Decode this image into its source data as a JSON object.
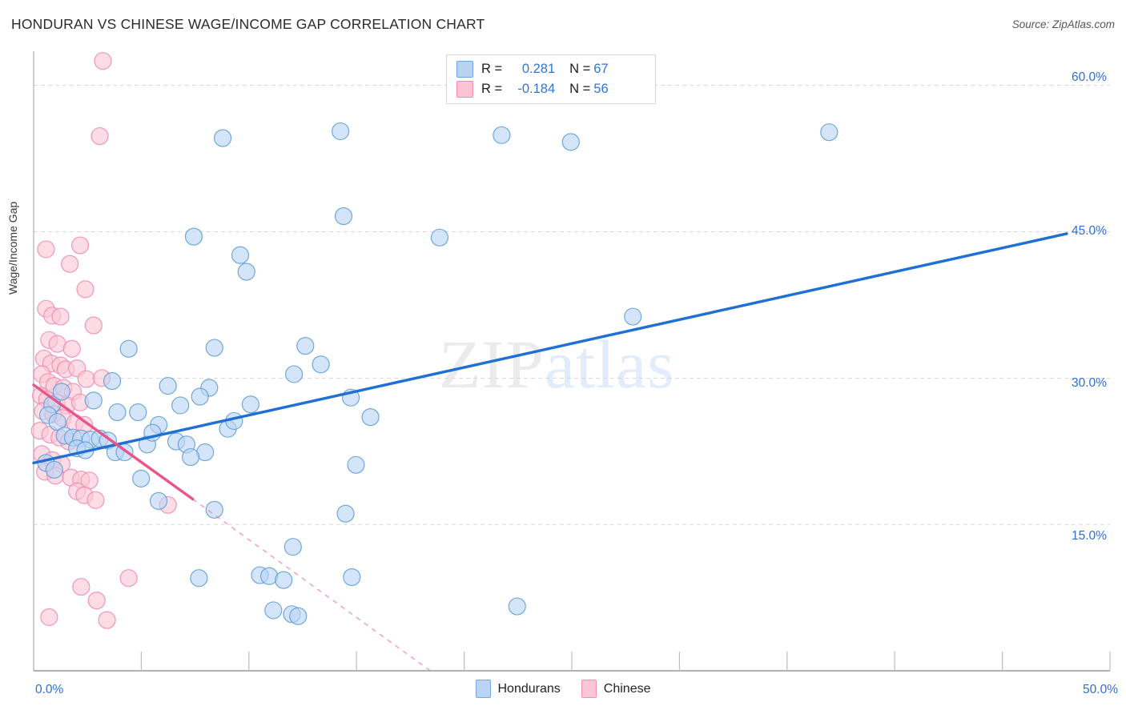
{
  "header": {
    "title": "HONDURAN VS CHINESE WAGE/INCOME GAP CORRELATION CHART",
    "source": "Source: ZipAtlas.com"
  },
  "watermark": {
    "part1": "ZIP",
    "part2": "atlas"
  },
  "stats": {
    "rows": [
      {
        "series": "Hondurans",
        "r_key": "R =",
        "r_value": "0.281",
        "n_key": "N =",
        "n_value": "67",
        "color": "#b8d3f2"
      },
      {
        "series": "Chinese",
        "r_key": "R =",
        "r_value": "-0.184",
        "n_key": "N =",
        "n_value": "56",
        "color": "#fbc4d4"
      }
    ]
  },
  "legend": {
    "items": [
      {
        "label": "Hondurans",
        "color": "#b9d4f5"
      },
      {
        "label": "Chinese",
        "color": "#fbc6d6"
      }
    ]
  },
  "axes": {
    "y_title": "Wage/Income Gap",
    "y_ticks": [
      "60.0%",
      "45.0%",
      "30.0%",
      "15.0%"
    ],
    "x_min_label": "0.0%",
    "x_max_label": "50.0%"
  },
  "chart_data": {
    "type": "scatter",
    "title": "HONDURAN VS CHINESE WAGE/INCOME GAP CORRELATION CHART",
    "xlabel": "",
    "ylabel": "Wage/Income Gap",
    "xlim": [
      0.0,
      50.0
    ],
    "ylim": [
      0.0,
      63.5
    ],
    "x_unit": "%",
    "y_unit": "%",
    "grid": true,
    "y_gridlines": [
      15.0,
      30.0,
      45.0,
      60.0
    ],
    "legend_position": "bottom-center",
    "series": [
      {
        "name": "Hondurans",
        "color": "#b9d4f5",
        "edge_color": "#5b9bd5",
        "r": 0.281,
        "n": 67,
        "trendline": {
          "x0": 0.0,
          "y0": 21.3,
          "x1": 50.0,
          "y1": 44.8,
          "style": "solid",
          "color": "#1f6fd4"
        },
        "points": [
          [
            14.85,
            55.3
          ],
          [
            22.65,
            54.9
          ],
          [
            26.0,
            54.2
          ],
          [
            38.5,
            55.2
          ],
          [
            9.15,
            54.6
          ],
          [
            15.0,
            46.6
          ],
          [
            7.75,
            44.5
          ],
          [
            19.65,
            44.4
          ],
          [
            10.0,
            42.6
          ],
          [
            10.3,
            40.9
          ],
          [
            4.6,
            33.0
          ],
          [
            8.75,
            33.1
          ],
          [
            13.15,
            33.3
          ],
          [
            29.0,
            36.3
          ],
          [
            13.9,
            31.4
          ],
          [
            3.8,
            29.7
          ],
          [
            6.5,
            29.2
          ],
          [
            12.6,
            30.4
          ],
          [
            8.5,
            29.0
          ],
          [
            2.9,
            27.7
          ],
          [
            7.1,
            27.2
          ],
          [
            8.05,
            28.1
          ],
          [
            4.05,
            26.5
          ],
          [
            5.05,
            26.5
          ],
          [
            6.05,
            25.2
          ],
          [
            9.4,
            24.8
          ],
          [
            10.5,
            27.3
          ],
          [
            15.35,
            28.0
          ],
          [
            16.3,
            26.0
          ],
          [
            0.9,
            27.3
          ],
          [
            0.7,
            26.2
          ],
          [
            1.15,
            25.5
          ],
          [
            1.5,
            24.1
          ],
          [
            1.9,
            23.9
          ],
          [
            2.3,
            23.8
          ],
          [
            2.75,
            23.7
          ],
          [
            3.2,
            23.8
          ],
          [
            3.6,
            23.6
          ],
          [
            2.1,
            22.8
          ],
          [
            2.5,
            22.6
          ],
          [
            3.95,
            22.4
          ],
          [
            4.4,
            22.4
          ],
          [
            5.5,
            23.2
          ],
          [
            6.9,
            23.5
          ],
          [
            7.4,
            23.2
          ],
          [
            8.3,
            22.4
          ],
          [
            7.6,
            21.9
          ],
          [
            15.6,
            21.1
          ],
          [
            0.6,
            21.3
          ],
          [
            1.0,
            20.6
          ],
          [
            5.2,
            19.7
          ],
          [
            6.05,
            17.4
          ],
          [
            8.75,
            16.5
          ],
          [
            15.1,
            16.1
          ],
          [
            12.55,
            12.7
          ],
          [
            8.0,
            9.5
          ],
          [
            10.95,
            9.8
          ],
          [
            11.4,
            9.7
          ],
          [
            12.1,
            9.3
          ],
          [
            15.4,
            9.6
          ],
          [
            11.6,
            6.2
          ],
          [
            12.5,
            5.8
          ],
          [
            12.8,
            5.6
          ],
          [
            23.4,
            6.6
          ],
          [
            9.7,
            25.6
          ],
          [
            5.75,
            24.4
          ],
          [
            1.35,
            28.6
          ]
        ]
      },
      {
        "name": "Chinese",
        "color": "#fbc6d6",
        "edge_color": "#ef87ab",
        "r": -0.184,
        "n": 56,
        "trendline": {
          "x0": 0.0,
          "y0": 29.3,
          "x1": 7.7,
          "y1": 17.6,
          "style": "solid",
          "color": "#e8558b",
          "extension": {
            "x0": 7.7,
            "y0": 17.6,
            "x1": 19.2,
            "y1": 0.0,
            "style": "dashed"
          }
        },
        "points": [
          [
            3.35,
            62.5
          ],
          [
            3.2,
            54.8
          ],
          [
            2.25,
            43.6
          ],
          [
            0.6,
            43.2
          ],
          [
            1.75,
            41.7
          ],
          [
            2.5,
            39.1
          ],
          [
            0.6,
            37.1
          ],
          [
            0.9,
            36.4
          ],
          [
            1.3,
            36.3
          ],
          [
            2.9,
            35.4
          ],
          [
            0.75,
            33.9
          ],
          [
            1.15,
            33.5
          ],
          [
            1.85,
            33.0
          ],
          [
            0.5,
            32.0
          ],
          [
            0.85,
            31.5
          ],
          [
            1.3,
            31.3
          ],
          [
            1.55,
            30.9
          ],
          [
            2.1,
            31.0
          ],
          [
            2.55,
            29.9
          ],
          [
            3.3,
            30.0
          ],
          [
            0.4,
            30.4
          ],
          [
            0.7,
            29.6
          ],
          [
            1.0,
            29.2
          ],
          [
            1.45,
            29.0
          ],
          [
            1.9,
            28.6
          ],
          [
            0.35,
            28.2
          ],
          [
            0.65,
            27.8
          ],
          [
            1.1,
            27.5
          ],
          [
            1.6,
            27.2
          ],
          [
            2.25,
            27.5
          ],
          [
            0.45,
            26.6
          ],
          [
            0.95,
            26.3
          ],
          [
            1.4,
            25.9
          ],
          [
            2.0,
            25.4
          ],
          [
            2.45,
            25.2
          ],
          [
            0.3,
            24.6
          ],
          [
            0.8,
            24.2
          ],
          [
            1.25,
            23.9
          ],
          [
            1.7,
            23.5
          ],
          [
            0.4,
            22.2
          ],
          [
            0.9,
            21.6
          ],
          [
            1.35,
            21.2
          ],
          [
            0.55,
            20.4
          ],
          [
            1.05,
            20.0
          ],
          [
            1.8,
            19.8
          ],
          [
            2.3,
            19.6
          ],
          [
            2.7,
            19.5
          ],
          [
            2.1,
            18.4
          ],
          [
            2.45,
            18.0
          ],
          [
            3.0,
            17.5
          ],
          [
            6.5,
            17.0
          ],
          [
            4.6,
            9.5
          ],
          [
            2.3,
            8.6
          ],
          [
            3.05,
            7.2
          ],
          [
            0.75,
            5.5
          ],
          [
            3.55,
            5.2
          ]
        ]
      }
    ]
  }
}
